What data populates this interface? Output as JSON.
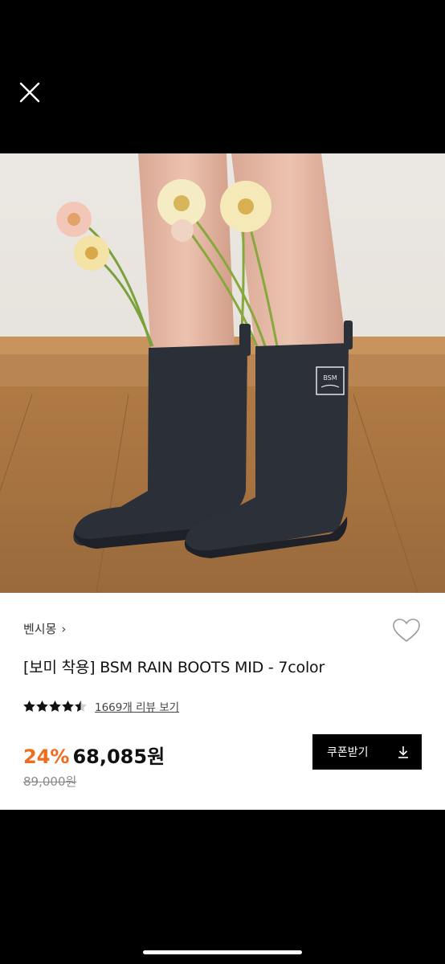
{
  "header": {
    "close_icon": "close-icon"
  },
  "product": {
    "brand": "벤시몽",
    "brand_chevron": "›",
    "title": "[보미 착용] BSM RAIN BOOTS MID - 7color",
    "rating_stars": 4.5,
    "review_link": "1669개 리뷰 보기",
    "discount": "24%",
    "price": "68,085원",
    "original_price": "89,000원",
    "wishlist_icon": "heart-outline-icon"
  },
  "image": {
    "patch_text": "BSM",
    "carousel_progress": 0.17
  },
  "coupon": {
    "label": "쿠폰받기",
    "icon": "download-icon"
  },
  "colors": {
    "discount": "#f26a1b",
    "button_bg": "#000000",
    "background": "#000000"
  }
}
